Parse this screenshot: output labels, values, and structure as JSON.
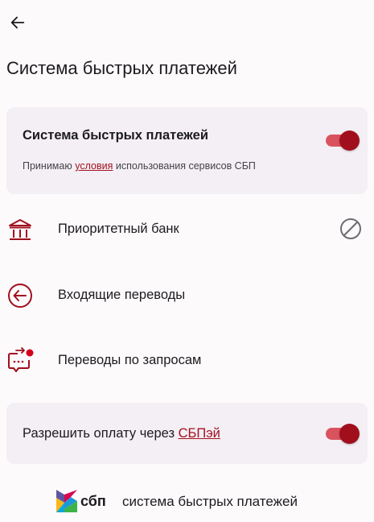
{
  "header": {
    "title": "Система быстрых платежей"
  },
  "sbp_card": {
    "title": "Система быстрых платежей",
    "enabled": true,
    "terms_prefix": "Принимаю",
    "terms_link": "условия",
    "terms_suffix": "использования сервисов СБП"
  },
  "menu": {
    "priority_bank": "Приоритетный банк",
    "incoming": "Входящие переводы",
    "requests": "Переводы по запросам"
  },
  "sbpay_card": {
    "label_prefix": "Разрешить оплату через",
    "label_link": "СБПэй",
    "enabled": true
  },
  "footer": {
    "brand_short": "сбп",
    "brand_full": "система быстрых платежей"
  },
  "colors": {
    "accent": "#a10f1d",
    "toggle_track": "#d9535e",
    "card_bg": "#f3eff4",
    "page_bg": "#fdfafc"
  }
}
